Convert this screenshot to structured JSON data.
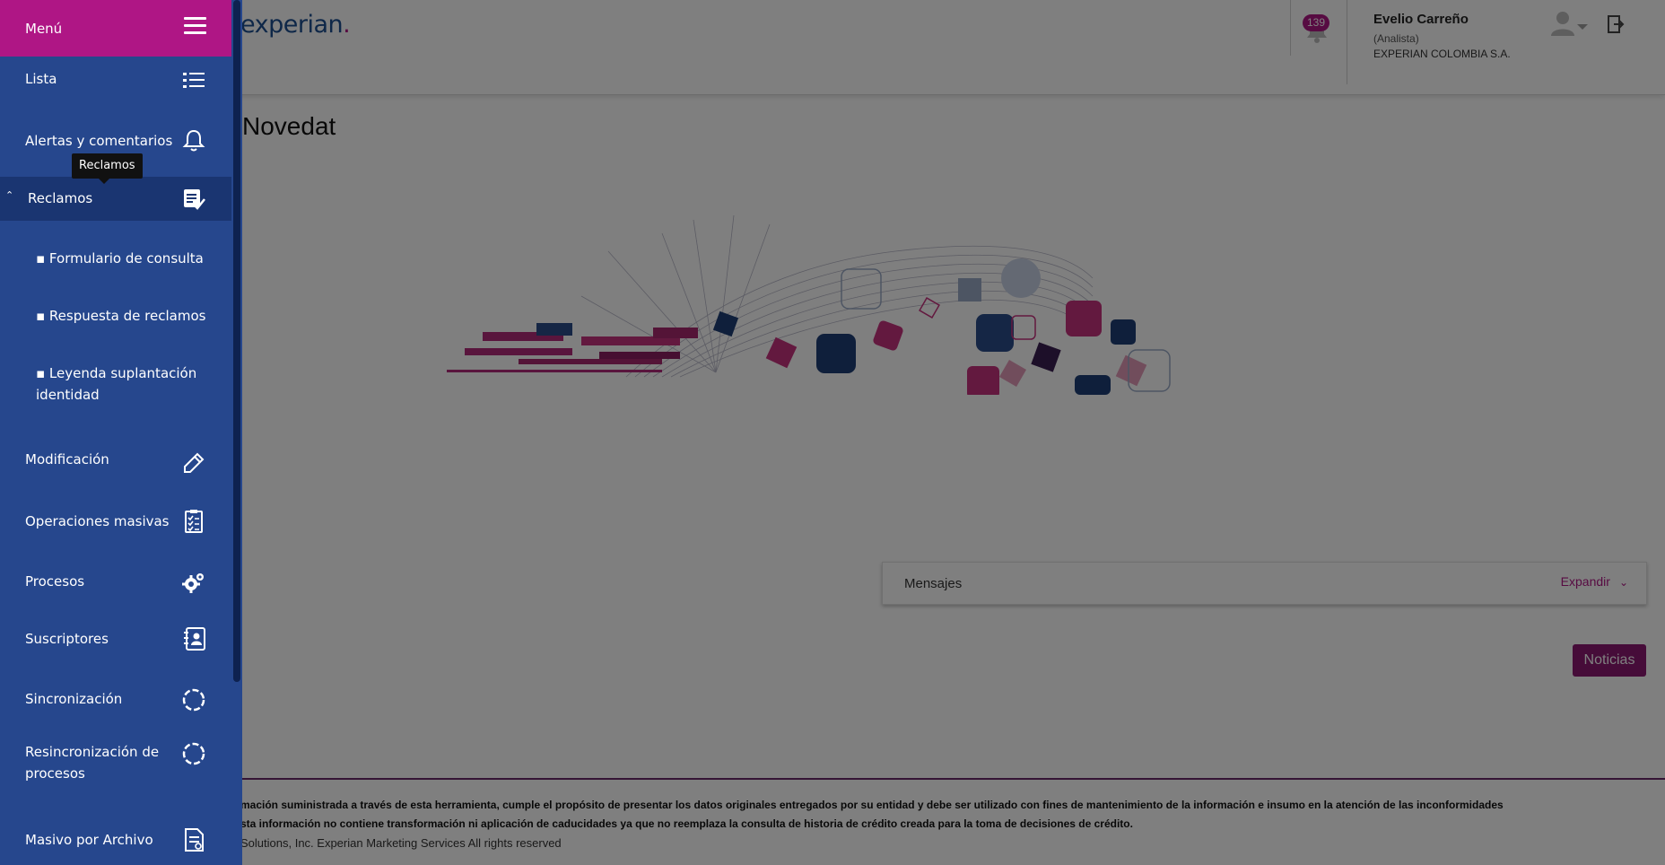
{
  "header": {
    "logo_text": "experian",
    "logo_dot": ".",
    "notification_count": "139",
    "user_name": "Evelio Carreño",
    "user_role": "(Analista)",
    "user_company": "EXPERIAN COLOMBIA S.A."
  },
  "main": {
    "title": "Novedat",
    "messages_label": "Mensajes",
    "messages_expand": "Expandir",
    "news_button": "Noticias"
  },
  "footer": {
    "line1": "mación suministrada a través de esta herramienta, cumple el propósito de presentar los datos originales entregados por su entidad y debe ser utilizado con fines de mantenimiento de la información e insumo en la atención de las inconformidades",
    "line2": "sta información no contiene transformación ni aplicación de caducidades ya que no reemplaza la consulta de historia de crédito creada para la toma de decisiones de crédito.",
    "copyright": "Solutions, Inc. Experian Marketing Services All rights reserved"
  },
  "sidebar": {
    "title": "Menú",
    "tooltip": "Reclamos",
    "items": [
      {
        "label": "Lista",
        "icon": "list-icon"
      },
      {
        "label": "Alertas y comentarios",
        "icon": "bell-icon"
      },
      {
        "label": "Reclamos",
        "icon": "document-check-icon"
      },
      {
        "label": "Modificación",
        "icon": "pencil-icon"
      },
      {
        "label": "Operaciones masivas",
        "icon": "checklist-icon"
      },
      {
        "label": "Procesos",
        "icon": "gears-icon"
      },
      {
        "label": "Suscriptores",
        "icon": "contacts-icon"
      },
      {
        "label": "Sincronización",
        "icon": "sync-icon"
      },
      {
        "label": "Resincronización de procesos",
        "icon": "sync-icon"
      },
      {
        "label": "Masivo por Archivo",
        "icon": "file-icon"
      }
    ],
    "subitems": [
      {
        "label": "▪ Formulario de consulta"
      },
      {
        "label": "▪ Respuesta de reclamos"
      },
      {
        "label": "▪ Leyenda suplantación identidad"
      }
    ]
  },
  "colors": {
    "sidebar": "#26478d",
    "sidebar_active": "#1a3571",
    "menu_header": "#af1685",
    "brand_blue": "#1d4f91",
    "brand_magenta": "#af1685",
    "news_button": "#8d1873"
  }
}
